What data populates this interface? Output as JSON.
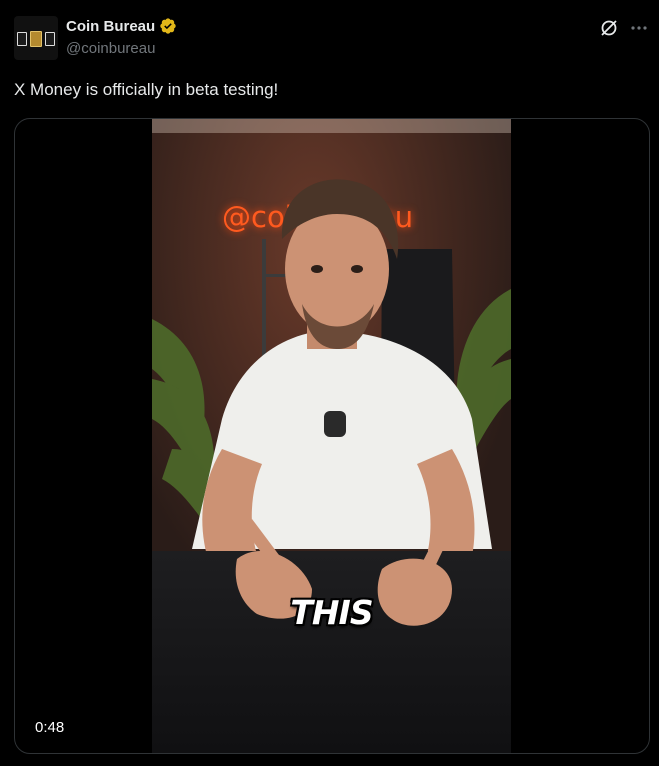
{
  "author": {
    "name": "Coin Bureau",
    "handle": "@coinbureau",
    "verified_color": "#e2b719"
  },
  "post": {
    "text": "X Money is officially in beta testing!"
  },
  "media": {
    "type": "video",
    "duration": "0:48",
    "caption": "THIS",
    "neon_sign": "@coinbureau"
  },
  "icons": [
    "grok-icon",
    "more-icon",
    "verified-badge-icon"
  ],
  "colors": {
    "background": "#000000",
    "text_primary": "#e7e9ea",
    "text_secondary": "#71767b",
    "border": "#2f3336",
    "neon": "#ff5a1f"
  }
}
